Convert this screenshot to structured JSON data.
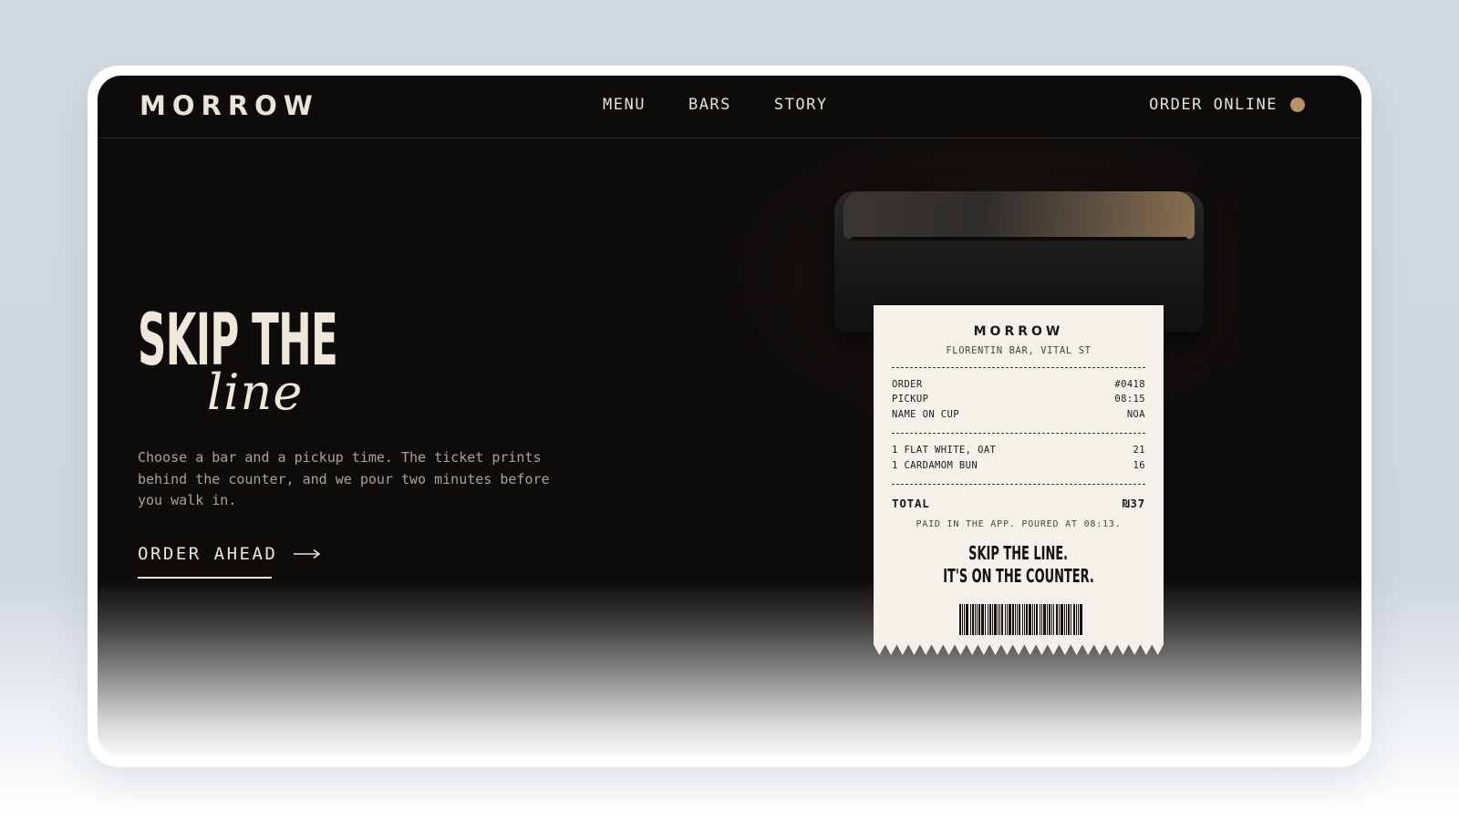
{
  "brand": {
    "logo": "MORROW"
  },
  "nav": {
    "links": [
      "MENU",
      "BARS",
      "STORY"
    ],
    "order_online": "ORDER ONLINE"
  },
  "hero": {
    "headline": "SKIP THE",
    "headline_script": "line",
    "lead": "Choose a bar and a pickup time. The ticket prints behind the counter, and we pour two minutes before you walk in.",
    "cta_label": "ORDER AHEAD",
    "cta_arrow": "⟶"
  },
  "receipt": {
    "brand": "MORROW",
    "location": "FLORENTIN BAR, VITAL ST",
    "meta": [
      {
        "label": "ORDER",
        "value": "#0418"
      },
      {
        "label": "PICKUP",
        "value": "08:15"
      },
      {
        "label": "NAME ON CUP",
        "value": "NOA"
      }
    ],
    "items": [
      {
        "label": "1 FLAT WHITE, OAT",
        "value": "21"
      },
      {
        "label": "1 CARDAMOM BUN",
        "value": "16"
      }
    ],
    "total_label": "TOTAL",
    "total_value": "₪37",
    "note": "PAID IN THE APP. POURED AT 08:13.",
    "slogan_line1": "SKIP THE LINE.",
    "slogan_line2": "IT'S ON THE COUNTER."
  },
  "colors": {
    "background": "#0e0c0b",
    "accent_dot": "#b99269",
    "text": "#efe7da",
    "receipt_paper": "#f5f1ea"
  }
}
